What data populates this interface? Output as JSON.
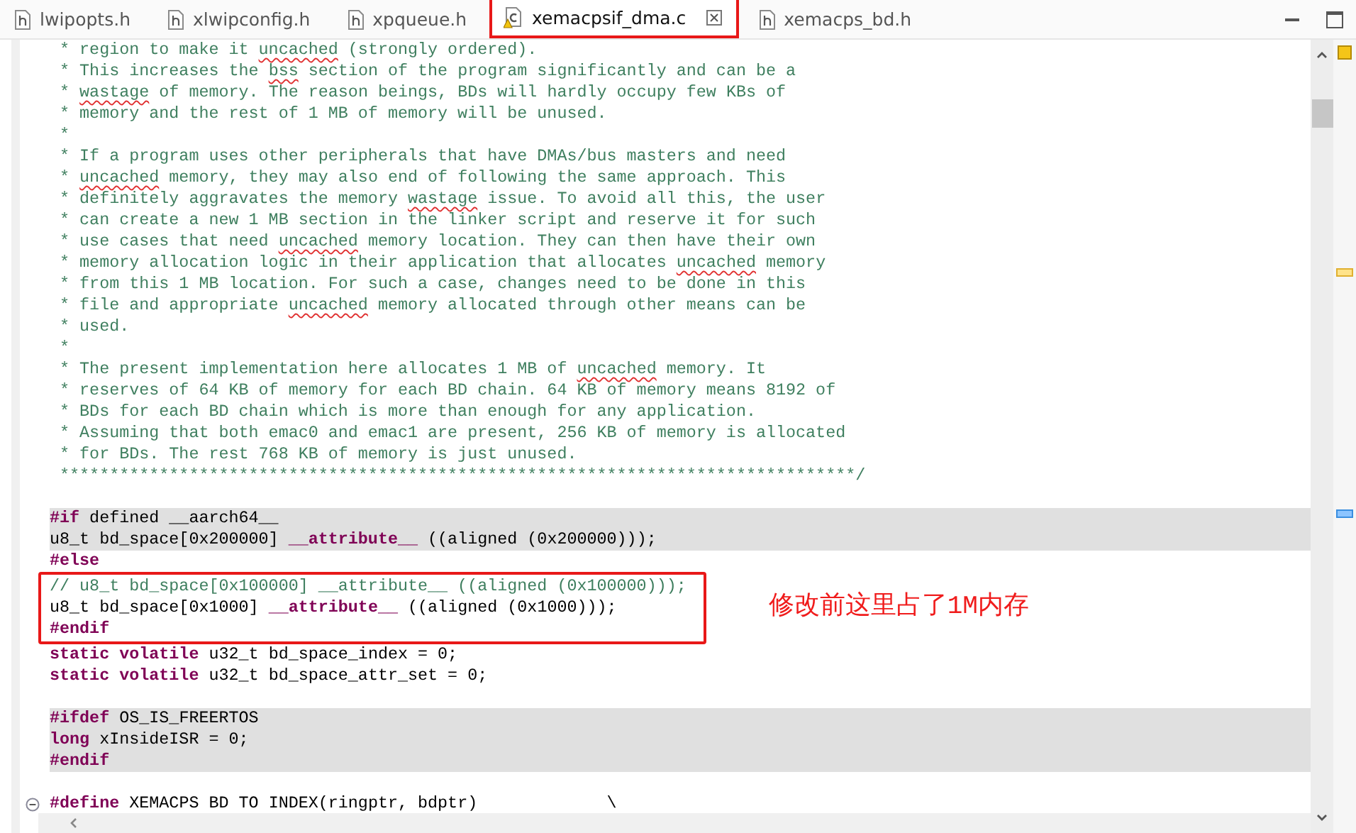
{
  "tabs": [
    {
      "label": "lwipopts.h",
      "kind": "header",
      "selected": false,
      "annotated": false
    },
    {
      "label": "xlwipconfig.h",
      "kind": "header",
      "selected": false,
      "annotated": false
    },
    {
      "label": "xpqueue.h",
      "kind": "header",
      "selected": false,
      "annotated": false
    },
    {
      "label": "xemacpsif_dma.c",
      "kind": "source",
      "selected": true,
      "annotated": true
    },
    {
      "label": "xemacps_bd.h",
      "kind": "header",
      "selected": false,
      "annotated": false
    }
  ],
  "code": {
    "blocks": [
      {
        "boxed": false,
        "shaded": false,
        "gap_after": true,
        "lines": [
          {
            "parts": [
              {
                "kind": "comment",
                "text": " * region to make it "
              },
              {
                "kind": "misspelled",
                "text": "uncached"
              },
              {
                "kind": "comment",
                "text": " (strongly ordered)."
              }
            ]
          },
          {
            "parts": [
              {
                "kind": "comment",
                "text": " * This increases the "
              },
              {
                "kind": "misspelled",
                "text": "bss"
              },
              {
                "kind": "comment",
                "text": " section of the program significantly and can be a"
              }
            ]
          },
          {
            "parts": [
              {
                "kind": "comment",
                "text": " * "
              },
              {
                "kind": "misspelled",
                "text": "wastage"
              },
              {
                "kind": "comment",
                "text": " of memory. The reason beings, BDs will hardly occupy few KBs of"
              }
            ]
          },
          {
            "parts": [
              {
                "kind": "comment",
                "text": " * memory and the rest of 1 MB of memory will be unused."
              }
            ]
          },
          {
            "parts": [
              {
                "kind": "comment",
                "text": " *"
              }
            ]
          },
          {
            "parts": [
              {
                "kind": "comment",
                "text": " * If a program uses other peripherals that have DMAs/bus masters and need"
              }
            ]
          },
          {
            "parts": [
              {
                "kind": "comment",
                "text": " * "
              },
              {
                "kind": "misspelled",
                "text": "uncached"
              },
              {
                "kind": "comment",
                "text": " memory, they may also end of following the same approach. This"
              }
            ]
          },
          {
            "parts": [
              {
                "kind": "comment",
                "text": " * definitely aggravates the memory "
              },
              {
                "kind": "misspelled",
                "text": "wastage"
              },
              {
                "kind": "comment",
                "text": " issue. To avoid all this, the user"
              }
            ]
          },
          {
            "parts": [
              {
                "kind": "comment",
                "text": " * can create a new 1 MB section in the linker script and reserve it for such"
              }
            ]
          },
          {
            "parts": [
              {
                "kind": "comment",
                "text": " * use cases that need "
              },
              {
                "kind": "misspelled",
                "text": "uncached"
              },
              {
                "kind": "comment",
                "text": " memory location. They can then have their own"
              }
            ]
          },
          {
            "parts": [
              {
                "kind": "comment",
                "text": " * memory allocation logic in their application that allocates "
              },
              {
                "kind": "misspelled",
                "text": "uncached"
              },
              {
                "kind": "comment",
                "text": " memory"
              }
            ]
          },
          {
            "parts": [
              {
                "kind": "comment",
                "text": " * from this 1 MB location. For such a case, changes need to be done in this"
              }
            ]
          },
          {
            "parts": [
              {
                "kind": "comment",
                "text": " * file and appropriate "
              },
              {
                "kind": "misspelled",
                "text": "uncached"
              },
              {
                "kind": "comment",
                "text": " memory allocated through other means can be"
              }
            ]
          },
          {
            "parts": [
              {
                "kind": "comment",
                "text": " * used."
              }
            ]
          },
          {
            "parts": [
              {
                "kind": "comment",
                "text": " *"
              }
            ]
          },
          {
            "parts": [
              {
                "kind": "comment",
                "text": " * The present implementation here allocates 1 MB of "
              },
              {
                "kind": "misspelled",
                "text": "uncached"
              },
              {
                "kind": "comment",
                "text": " memory. It"
              }
            ]
          },
          {
            "parts": [
              {
                "kind": "comment",
                "text": " * reserves of 64 KB of memory for each BD chain. 64 KB of memory means 8192 of"
              }
            ]
          },
          {
            "parts": [
              {
                "kind": "comment",
                "text": " * BDs for each BD chain which is more than enough for any application."
              }
            ]
          },
          {
            "parts": [
              {
                "kind": "comment",
                "text": " * Assuming that both emac0 and emac1 are present, 256 KB of memory is allocated"
              }
            ]
          },
          {
            "parts": [
              {
                "kind": "comment",
                "text": " * for BDs. The rest 768 KB of memory is just unused."
              }
            ]
          },
          {
            "parts": [
              {
                "kind": "comment",
                "text": " ********************************************************************************/"
              }
            ]
          }
        ]
      },
      {
        "boxed": false,
        "shaded": true,
        "gap_after": false,
        "lines": [
          {
            "parts": [
              {
                "kind": "keyword",
                "text": "#if"
              },
              {
                "kind": "plain",
                "text": " defined __aarch64__"
              }
            ]
          },
          {
            "parts": [
              {
                "kind": "plain",
                "text": "u8_t bd_space[0x200000] "
              },
              {
                "kind": "keyword",
                "text": "__attribute__"
              },
              {
                "kind": "plain",
                "text": " ((aligned (0x200000)));"
              }
            ]
          }
        ]
      },
      {
        "boxed": false,
        "shaded": false,
        "gap_after": false,
        "lines": [
          {
            "parts": [
              {
                "kind": "keyword",
                "text": "#else"
              }
            ]
          }
        ]
      },
      {
        "boxed": true,
        "shaded": false,
        "gap_after": false,
        "note": "修改前这里占了1M内存",
        "lines": [
          {
            "parts": [
              {
                "kind": "comment",
                "text": "// u8_t bd_space[0x100000] __attribute__ ((aligned (0x100000)));"
              }
            ]
          },
          {
            "parts": [
              {
                "kind": "plain",
                "text": "u8_t bd_space[0x1000] "
              },
              {
                "kind": "keyword",
                "text": "__attribute__"
              },
              {
                "kind": "plain",
                "text": " ((aligned (0x1000)));"
              }
            ]
          },
          {
            "parts": [
              {
                "kind": "keyword",
                "text": "#endif"
              }
            ]
          }
        ]
      },
      {
        "boxed": false,
        "shaded": false,
        "gap_after": true,
        "lines": [
          {
            "parts": [
              {
                "kind": "keyword",
                "text": "static volatile"
              },
              {
                "kind": "plain",
                "text": " u32_t bd_space_index = 0;"
              }
            ]
          },
          {
            "parts": [
              {
                "kind": "keyword",
                "text": "static volatile"
              },
              {
                "kind": "plain",
                "text": " u32_t bd_space_attr_set = 0;"
              }
            ]
          }
        ]
      },
      {
        "boxed": false,
        "shaded": true,
        "gap_after": true,
        "lines": [
          {
            "parts": [
              {
                "kind": "keyword",
                "text": "#ifdef"
              },
              {
                "kind": "plain",
                "text": " OS_IS_FREERTOS"
              }
            ]
          },
          {
            "parts": [
              {
                "kind": "keyword",
                "text": "long"
              },
              {
                "kind": "plain",
                "text": " xInsideISR = 0;"
              }
            ]
          },
          {
            "parts": [
              {
                "kind": "keyword",
                "text": "#endif"
              }
            ]
          }
        ]
      },
      {
        "boxed": false,
        "shaded": false,
        "gap_after": false,
        "lines": [
          {
            "foldable": true,
            "parts": [
              {
                "kind": "keyword",
                "text": "#define"
              },
              {
                "kind": "plain",
                "text": " XEMACPS BD TO INDEX(ringptr, bdptr)             \\"
              }
            ]
          }
        ]
      }
    ]
  }
}
